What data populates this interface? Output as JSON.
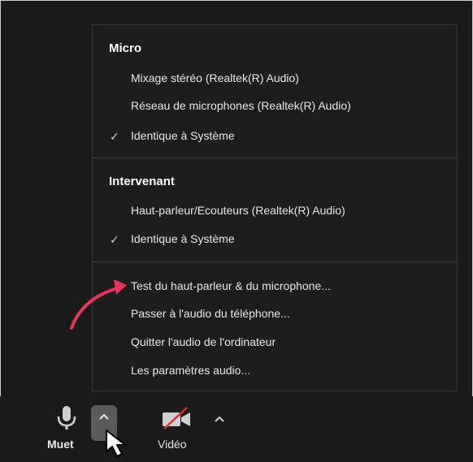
{
  "menu": {
    "micro_title": "Micro",
    "micro_items": [
      {
        "label": "Mixage stéréo (Realtek(R) Audio)",
        "checked": false
      },
      {
        "label": "Réseau de microphones (Realtek(R) Audio)",
        "checked": false
      },
      {
        "label": "Identique à Système",
        "checked": true
      }
    ],
    "speaker_title": "Intervenant",
    "speaker_items": [
      {
        "label": "Haut-parleur/Ecouteurs (Realtek(R) Audio)",
        "checked": false
      },
      {
        "label": "Identique à Système",
        "checked": true
      }
    ],
    "actions": [
      "Test du haut-parleur & du microphone...",
      "Passer à l'audio du téléphone...",
      "Quitter l'audio de l'ordinateur",
      "Les paramètres audio..."
    ],
    "check_glyph": "✓"
  },
  "toolbar": {
    "mute_label": "Muet",
    "video_label": "Vidéo",
    "caret_glyph": "^"
  },
  "colors": {
    "menu_bg": "#1d1d1d",
    "annotation_arrow": "#e8345a",
    "video_slash": "#e02a2a"
  }
}
